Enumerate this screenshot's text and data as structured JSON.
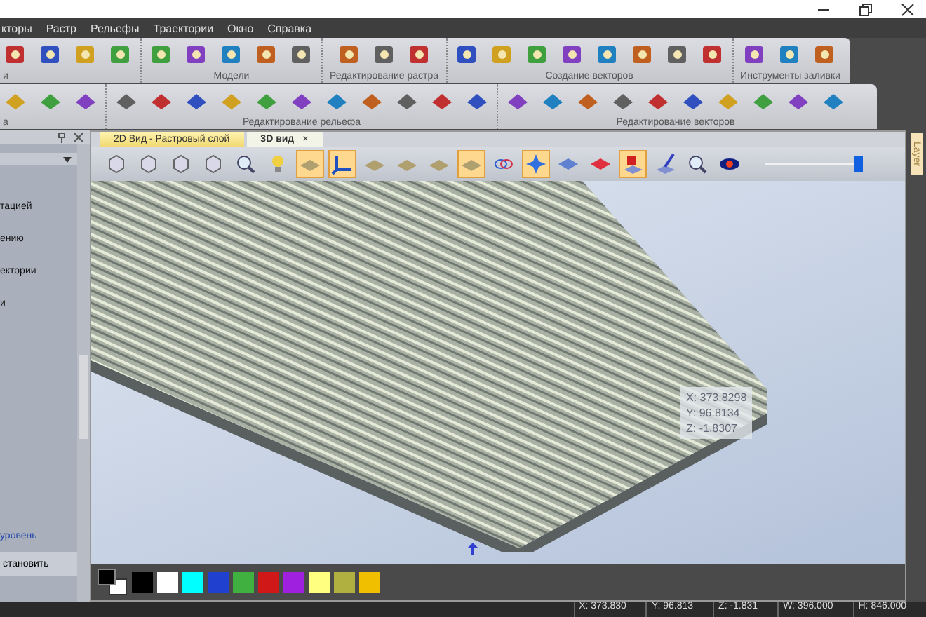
{
  "menu": [
    "кторы",
    "Растр",
    "Рельефы",
    "Траектории",
    "Окно",
    "Справка"
  ],
  "toolbar_row1": [
    {
      "label": "и"
    },
    {
      "label": "Модели"
    },
    {
      "label": "Редактирование растра"
    },
    {
      "label": "Создание векторов"
    },
    {
      "label": "Инструменты заливки"
    }
  ],
  "toolbar_row2": [
    {
      "label": "а"
    },
    {
      "label": "Редактирование рельефа"
    },
    {
      "label": "Редактирование векторов"
    }
  ],
  "left_panel": {
    "items": [
      "тацией",
      "ению",
      "ектории",
      "и"
    ],
    "link": "уровень",
    "button": "становить"
  },
  "tabs": [
    {
      "label": "2D Вид - Растровый слой",
      "selected": false
    },
    {
      "label": "3D вид",
      "selected": true,
      "close": "×"
    }
  ],
  "view_toolbar": [
    {
      "on": false
    },
    {
      "on": false
    },
    {
      "on": false
    },
    {
      "on": false
    },
    {
      "on": false
    },
    {
      "on": false
    },
    {
      "on": true
    },
    {
      "on": true
    },
    {
      "on": false
    },
    {
      "on": false
    },
    {
      "on": false
    },
    {
      "on": true
    },
    {
      "on": false
    },
    {
      "on": true
    },
    {
      "on": false
    },
    {
      "on": false
    },
    {
      "on": true
    },
    {
      "on": false
    },
    {
      "on": false
    },
    {
      "on": false
    }
  ],
  "view_slider": {
    "level": 1
  },
  "tooltip": [
    "X: 373.8298",
    "Y: 96.8134",
    "Z: -1.8307"
  ],
  "palette": [
    {
      "color": "#000000"
    },
    {
      "color": "#ffffff"
    },
    {
      "color": "#00ffff"
    },
    {
      "color": "#2040d0"
    },
    {
      "color": "#40b040"
    },
    {
      "color": "#d01818"
    },
    {
      "color": "#a020e0"
    },
    {
      "color": "#ffff80"
    },
    {
      "color": "#b0b040"
    },
    {
      "color": "#f0c000"
    }
  ],
  "side_tab": "Layer",
  "status_bar": [
    "X: 373.830",
    "Y: 96.813",
    "Z: -1.831",
    "W: 396.000",
    "H: 846.000"
  ]
}
